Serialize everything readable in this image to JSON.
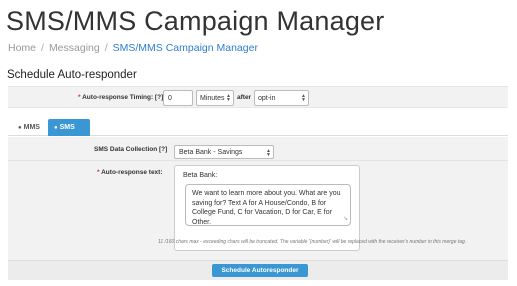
{
  "page": {
    "title": "SMS/MMS Campaign Manager"
  },
  "breadcrumb": {
    "items": [
      "Home",
      "Messaging",
      "SMS/MMS Campaign Manager"
    ],
    "separator": "/"
  },
  "section": {
    "title": "Schedule Auto-responder"
  },
  "timing": {
    "required_mark": "*",
    "label": "Auto-response Timing: [?]",
    "value": "0",
    "unit": "Minutes",
    "after_label": "after",
    "trigger": "opt-in"
  },
  "tabs": [
    {
      "label": "MMS",
      "icon": "chat-icon",
      "active": false
    },
    {
      "label": "SMS",
      "icon": "chat-icon",
      "active": true
    }
  ],
  "form": {
    "data_collection": {
      "label": "SMS Data Collection [?]",
      "value": "Beta Bank - Savings"
    },
    "auto_response": {
      "required_mark": "*",
      "label": "Auto-response text:",
      "prefix": "Beta Bank:",
      "text": "We want to learn more about you. What are you saving for? Text A for A House/Condo, B for College Fund, C for Vacation, D for Car, E for Other."
    },
    "help_text": "11 /160 chars max - exceeding chars will be truncated. The variable '{number}' will be replaced with the receiver's number in this merge tag."
  },
  "actions": {
    "submit_label": "Schedule Autoresponder"
  },
  "colors": {
    "accent": "#3a97d4",
    "required": "#c0392b"
  }
}
